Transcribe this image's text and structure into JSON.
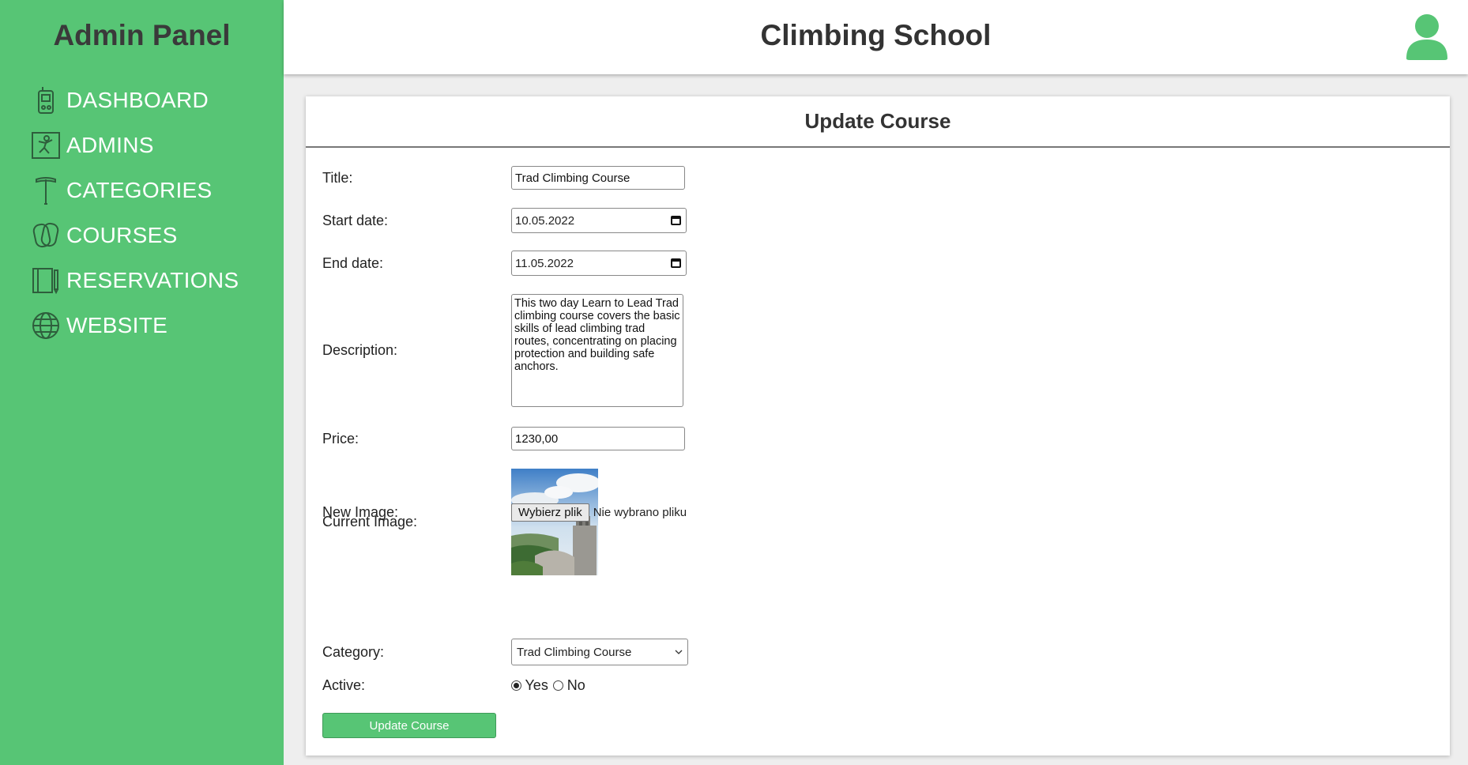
{
  "sidebar": {
    "title": "Admin Panel",
    "items": [
      {
        "label": "DASHBOARD",
        "icon": "dashboard-device-icon"
      },
      {
        "label": "ADMINS",
        "icon": "climber-icon"
      },
      {
        "label": "CATEGORIES",
        "icon": "ice-axe-icon"
      },
      {
        "label": "COURSES",
        "icon": "carabiner-icon"
      },
      {
        "label": "RESERVATIONS",
        "icon": "book-icon"
      },
      {
        "label": "WEBSITE",
        "icon": "globe-www-icon"
      }
    ]
  },
  "header": {
    "title": "Climbing School",
    "user_icon": "user-avatar-icon"
  },
  "form": {
    "heading": "Update Course",
    "title_label": "Title:",
    "title_value": "Trad Climbing Course",
    "start_label": "Start date:",
    "start_value": "10.05.2022",
    "end_label": "End date:",
    "end_value": "11.05.2022",
    "description_label": "Description:",
    "description_value": "This two day Learn to Lead Trad climbing course covers the basic skills of lead climbing trad routes, concentrating on placing protection and building safe anchors.",
    "price_label": "Price:",
    "price_value": "1230,00",
    "current_image_label": "Current Image:",
    "new_image_label": "New Image:",
    "file_button": "Wybierz plik",
    "file_status": "Nie wybrano pliku",
    "category_label": "Category:",
    "category_value": "Trad Climbing Course",
    "active_label": "Active:",
    "active_yes": "Yes",
    "active_no": "No",
    "active_selected": "Yes",
    "submit_label": "Update Course"
  },
  "colors": {
    "accent": "#57c575",
    "text_dark": "#333333"
  }
}
